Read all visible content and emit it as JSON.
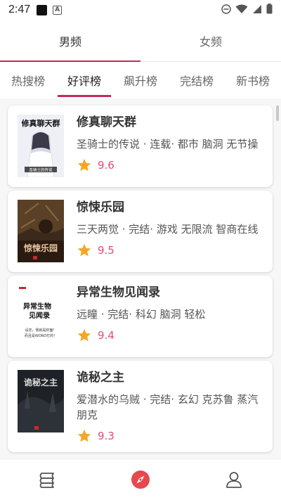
{
  "status_bar": {
    "time": "2:47",
    "icons": [
      "app-icon",
      "a-badge-icon",
      "dnd-icon",
      "wifi-icon",
      "signal-icon",
      "battery-icon"
    ]
  },
  "gender_tabs": [
    {
      "label": "男频",
      "active": true
    },
    {
      "label": "女频",
      "active": false
    }
  ],
  "category_tabs": [
    {
      "label": "热搜榜",
      "active": false
    },
    {
      "label": "好评榜",
      "active": true
    },
    {
      "label": "飙升榜",
      "active": false
    },
    {
      "label": "完结榜",
      "active": false
    },
    {
      "label": "新书榜",
      "active": false
    }
  ],
  "books": [
    {
      "title": "修真聊天群",
      "meta": "圣骑士的传说 · 连载· 都市 脑洞 无节操",
      "score": "9.6",
      "cover_text": "修真聊天群",
      "cover_sub": "圣骑士的传说"
    },
    {
      "title": "惊悚乐园",
      "meta": "三天两觉 · 完结· 游戏 无限流 智商在线",
      "score": "9.5",
      "cover_text": "惊悚乐园",
      "cover_sub": ""
    },
    {
      "title": "异常生物见闻录",
      "meta": "远瞳 · 完结· 科幻 脑洞 轻松",
      "score": "9.4",
      "cover_text": "异常生物见闻录",
      "cover_sub": "设定，我就是封面！而且是WORD打的！"
    },
    {
      "title": "诡秘之主",
      "meta": "爱潜水的乌贼 · 完结· 玄幻 克苏鲁 蒸汽朋克",
      "score": "9.3",
      "cover_text": "诡秘之主",
      "cover_sub": ""
    }
  ],
  "bottom_nav": [
    {
      "icon": "bookshelf-icon",
      "active": false
    },
    {
      "icon": "compass-icon",
      "active": true
    },
    {
      "icon": "profile-icon",
      "active": false
    }
  ],
  "colors": {
    "accent": "#c8285a",
    "score": "#e34d6e",
    "star": "#f5a623"
  }
}
